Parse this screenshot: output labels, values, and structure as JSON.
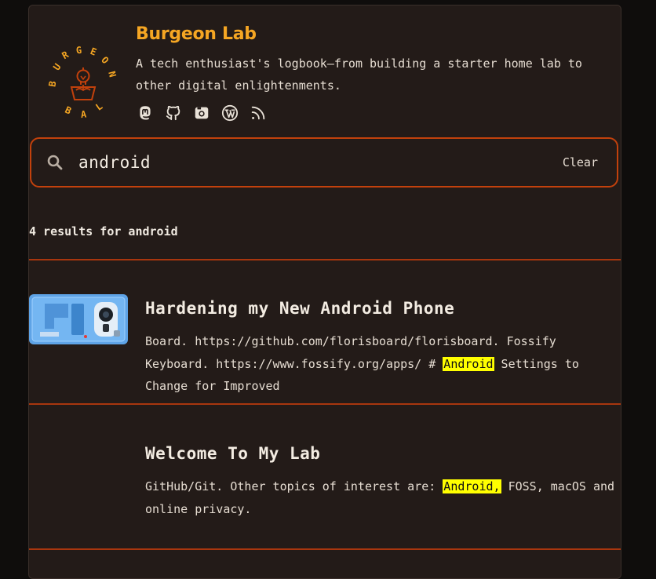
{
  "site": {
    "title": "Burgeon Lab",
    "tagline": "A tech enthusiast's logbook—from building a starter home lab to other digital enlightenments.",
    "logo_text": "BURGEON LAB"
  },
  "socials": [
    {
      "icon": "mastodon-icon"
    },
    {
      "icon": "github-icon"
    },
    {
      "icon": "camera-icon"
    },
    {
      "icon": "wordpress-icon"
    },
    {
      "icon": "rss-icon"
    }
  ],
  "search": {
    "value": "android",
    "clear_label": "Clear"
  },
  "results": {
    "count_text": "4 results for android",
    "items": [
      {
        "title": "Hardening my New Android Phone",
        "excerpt_before": "Board. https://github.com/florisboard/florisboard. Fossify Keyboard. https://www.fossify.org/apps/ # ",
        "highlight": "Android",
        "excerpt_after": " Settings to Change for Improved"
      },
      {
        "title": "Welcome To My Lab",
        "excerpt_before": "GitHub/Git. Other topics of interest are: ",
        "highlight": "Android,",
        "excerpt_after": " FOSS, macOS and online privacy."
      }
    ]
  },
  "colors": {
    "accent": "#f5a623",
    "border": "#c2410c",
    "panel_bg": "#231b18",
    "highlight": "#ffff00"
  }
}
